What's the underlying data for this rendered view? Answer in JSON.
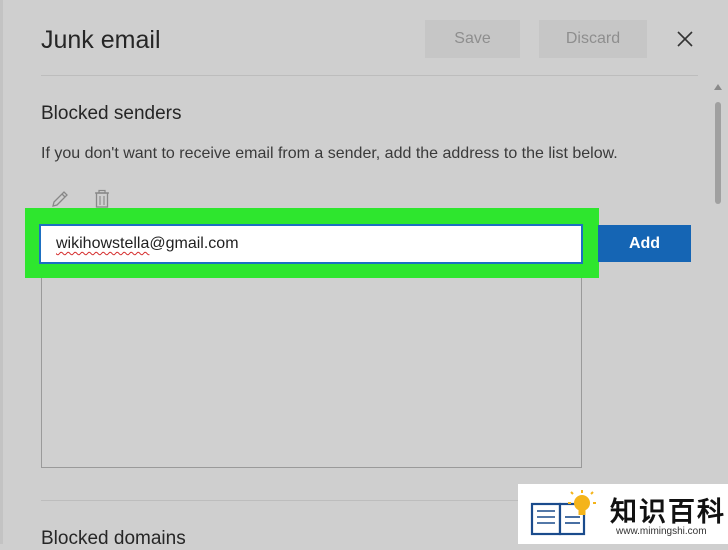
{
  "dialog": {
    "title": "Junk email",
    "save_label": "Save",
    "discard_label": "Discard",
    "close_icon": "close-icon"
  },
  "blocked_senders": {
    "heading": "Blocked senders",
    "description": "If you don't want to receive email from a sender, add the address to the list below.",
    "edit_icon": "pencil-icon",
    "delete_icon": "trash-icon",
    "input_value_underlined": "wikihowstella",
    "input_value_rest": "@gmail.com",
    "add_label": "Add"
  },
  "blocked_domains": {
    "heading": "Blocked domains"
  },
  "watermark": {
    "text": "知识百科",
    "url": "www.mimingshi.com"
  },
  "colors": {
    "accent": "#1565b4",
    "highlight": "#2ee62e",
    "background": "#cfcfcf"
  }
}
